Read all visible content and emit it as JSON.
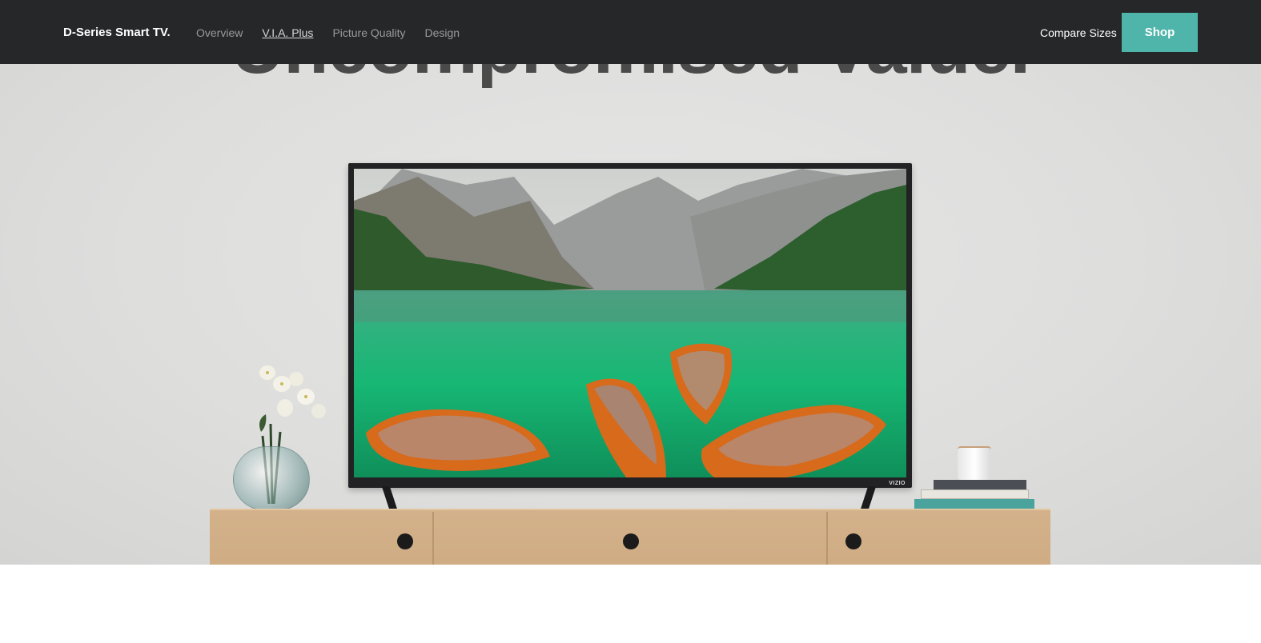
{
  "nav": {
    "brand": "D-Series Smart TV.",
    "links": [
      {
        "label": "Overview",
        "active": false
      },
      {
        "label": "V.I.A. Plus",
        "active": true
      },
      {
        "label": "Picture Quality",
        "active": false
      },
      {
        "label": "Design",
        "active": false
      }
    ],
    "compare_label": "Compare Sizes",
    "shop_label": "Shop",
    "background_color": "#262729",
    "accent_color": "#4fb5aa"
  },
  "hero": {
    "heading": "Uncompromised Value.",
    "tv_brand": "VIZIO",
    "background_color": "#dededd"
  }
}
